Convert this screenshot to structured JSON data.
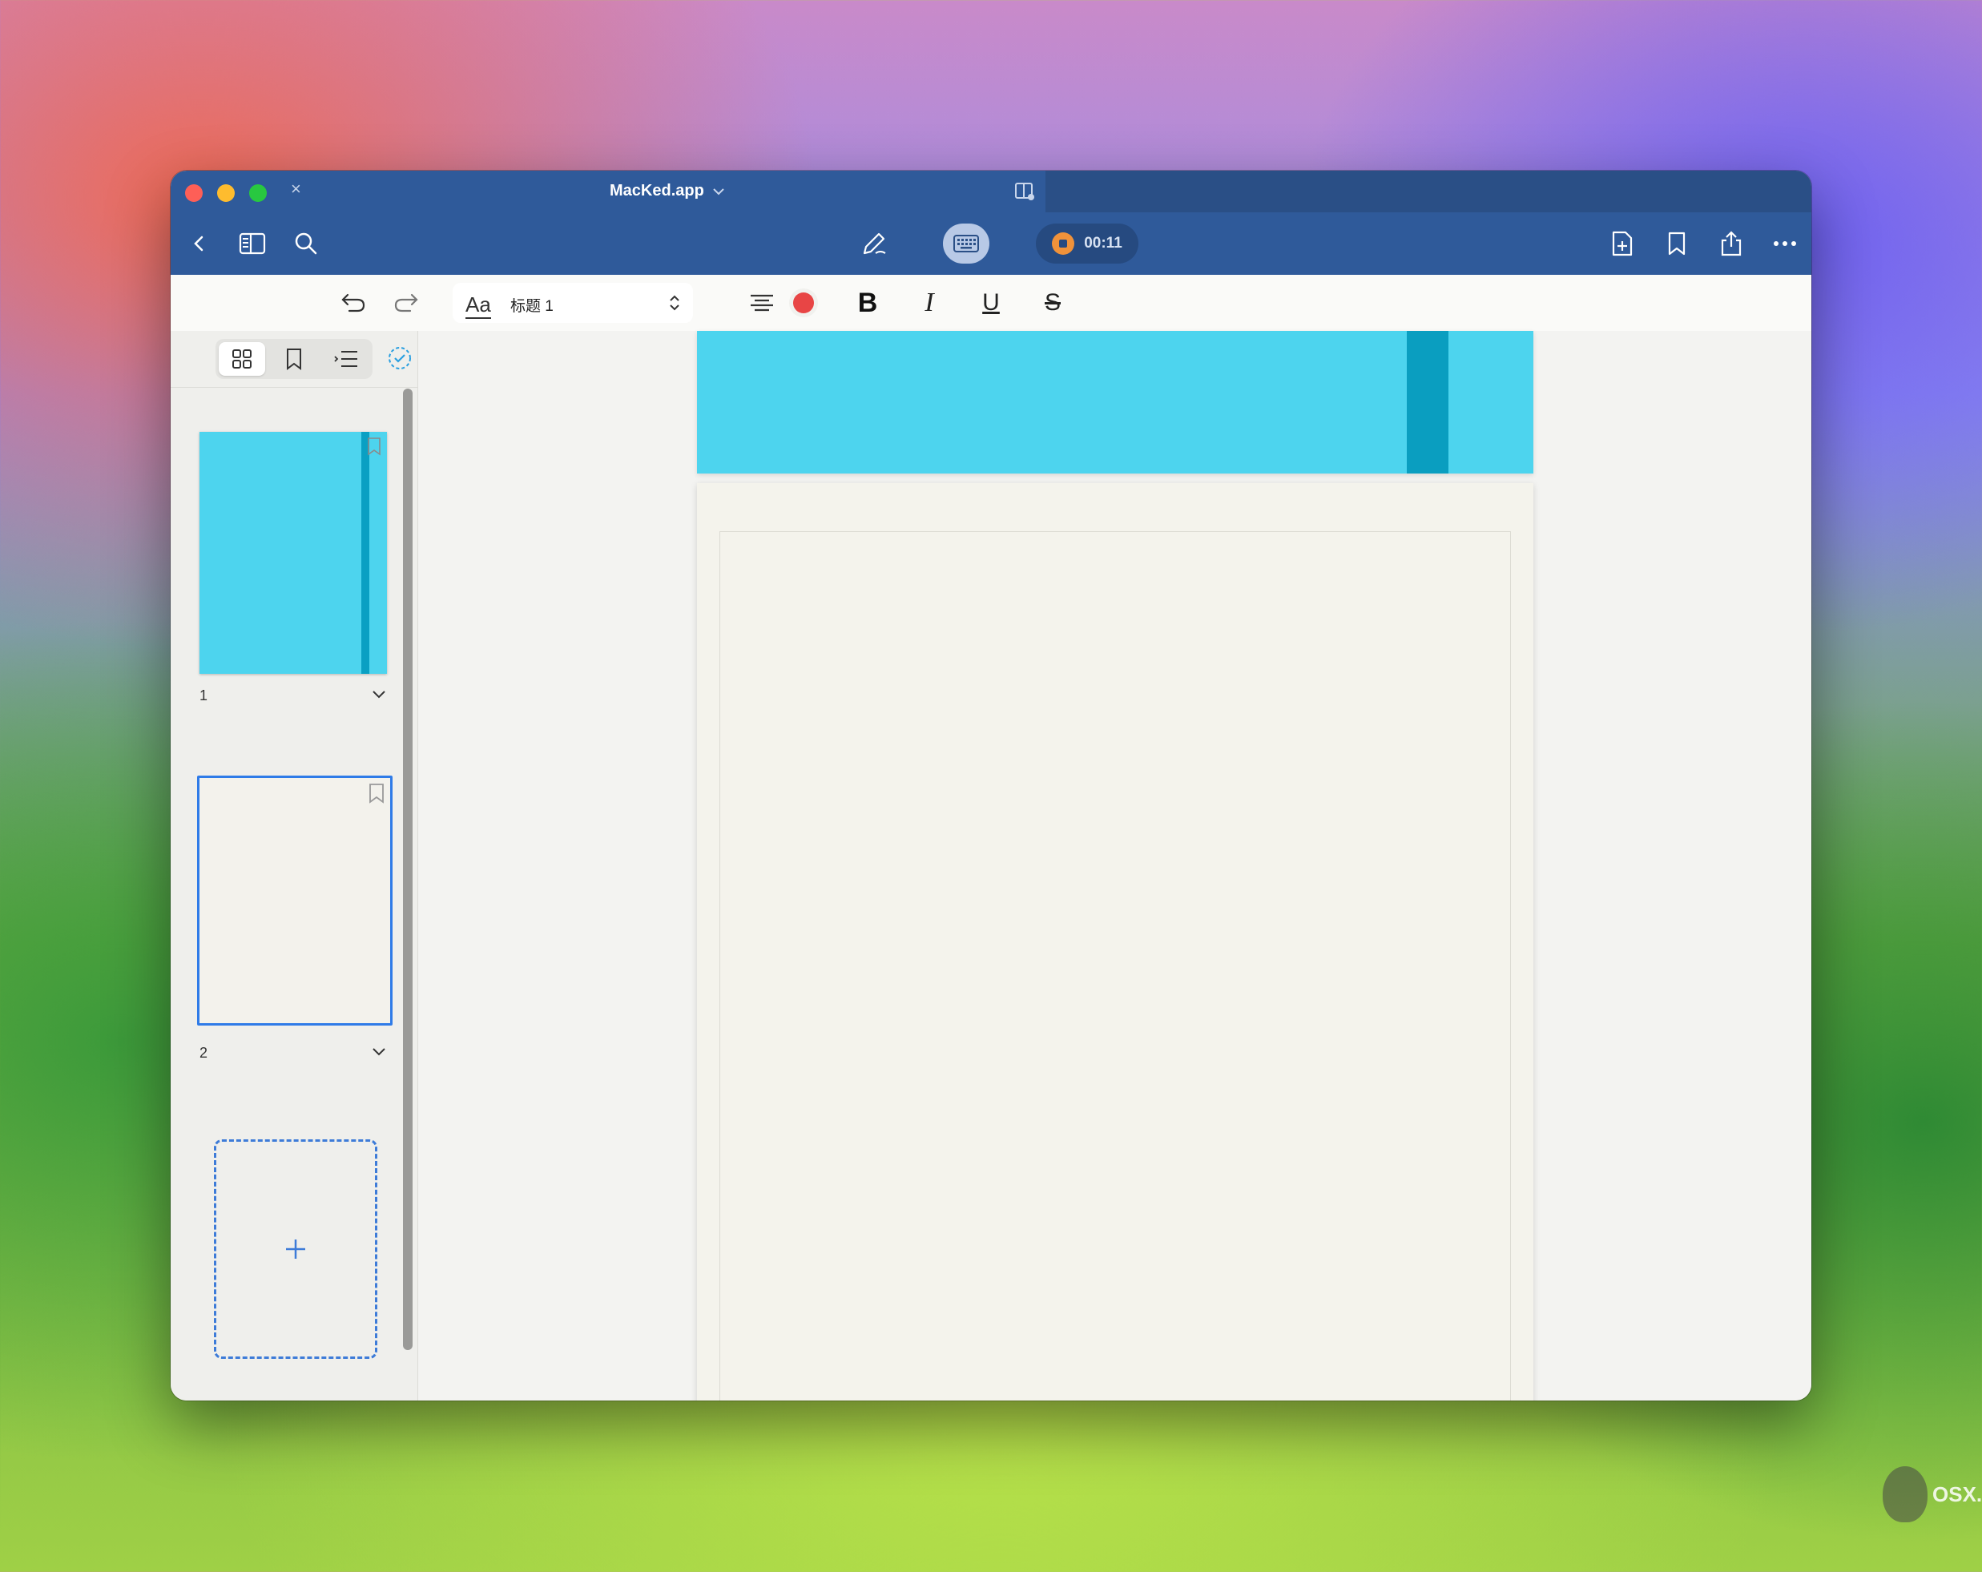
{
  "window": {
    "title": "MacKed.app",
    "tab_close": "×"
  },
  "toolbar": {
    "timer": "00:11",
    "icons": [
      "back-icon",
      "sidebar-toggle-icon",
      "search-icon",
      "pencil-icon",
      "keyboard-icon",
      "record-icon",
      "add-page-icon",
      "bookmark-icon",
      "share-icon",
      "more-icon"
    ]
  },
  "formatbar": {
    "font_glyph": "Aa",
    "style_name": "标题 1",
    "bold": "B",
    "italic": "I",
    "underline": "U",
    "strike": "S",
    "text_color": "#e84545"
  },
  "sidebar": {
    "tabs": [
      "thumbnails",
      "bookmarks",
      "outline"
    ],
    "pages": [
      {
        "number": "1",
        "color": "#4dd4ee"
      },
      {
        "number": "2",
        "color": "#f3f2ec"
      }
    ],
    "add_page_glyph": "+"
  },
  "watermark": "OSX.CX",
  "colors": {
    "titlebar": "#2f5a9a",
    "accent": "#2f7be8",
    "cover": "#4dd4ee"
  }
}
